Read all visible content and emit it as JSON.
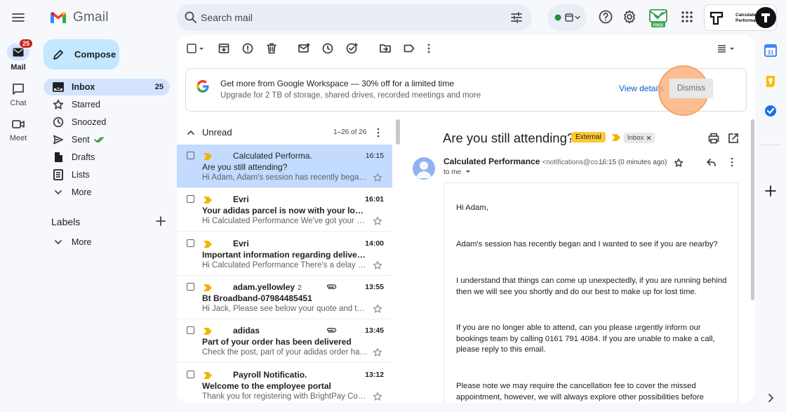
{
  "header": {
    "app_name": "Gmail",
    "search_placeholder": "Search mail",
    "account_label": "Calculated Performance"
  },
  "rail": {
    "mail_label": "Mail",
    "mail_badge": "25",
    "chat_label": "Chat",
    "meet_label": "Meet"
  },
  "nav": {
    "compose_label": "Compose",
    "items": [
      {
        "label": "Inbox",
        "count": "25"
      },
      {
        "label": "Starred"
      },
      {
        "label": "Snoozed"
      },
      {
        "label": "Sent"
      },
      {
        "label": "Drafts"
      },
      {
        "label": "Lists"
      },
      {
        "label": "More"
      }
    ],
    "labels_title": "Labels",
    "labels_more": "More"
  },
  "banner": {
    "title": "Get more from Google Workspace — 30% off for a limited time",
    "subtitle": "Upgrade for 2 TB of storage, shared drives, recorded meetings and more",
    "view_details": "View details",
    "dismiss": "Dismiss"
  },
  "list": {
    "section": "Unread",
    "range": "1–26 of 26",
    "messages": [
      {
        "sender": "Calculated Performa.",
        "count": "",
        "time": "16:15",
        "subject": "Are you still attending?",
        "snippet": "Hi Adam, Adam's session has recently began and I wanted to see if you are nearby?",
        "selected": true,
        "attachment": false
      },
      {
        "sender": "Evri",
        "count": "",
        "time": "16:01",
        "subject": "Your adidas parcel is now with your local Evri courier",
        "snippet": "Hi Calculated Performance We've got your adidas parcel",
        "selected": false,
        "attachment": false
      },
      {
        "sender": "Evri",
        "count": "",
        "time": "14:00",
        "subject": "Important information regarding delivery of your parcel",
        "snippet": "Hi Calculated Performance There's a delay with your parcel",
        "selected": false,
        "attachment": false
      },
      {
        "sender": "adam.yellowley",
        "count": "2",
        "time": "13:55",
        "subject": "Bt Broadband-07984485451",
        "snippet": "Hi Jack, Please see below your quote and the details",
        "selected": false,
        "attachment": true
      },
      {
        "sender": "adidas",
        "count": "",
        "time": "13:45",
        "subject": "Part of your order has been delivered",
        "snippet": "Check the post, part of your adidas order has arrived",
        "selected": false,
        "attachment": true
      },
      {
        "sender": "Payroll Notificatio.",
        "count": "",
        "time": "13:12",
        "subject": "Welcome to the employee portal",
        "snippet": "Thank you for registering with BrightPay Connect",
        "selected": false,
        "attachment": false
      }
    ]
  },
  "reader": {
    "subject": "Are you still attending?",
    "tag_external": "External",
    "tag_inbox": "Inbox",
    "from_name": "Calculated Performance",
    "from_addr": "<notifications@co...",
    "time": "16:15 (0 minutes ago)",
    "to": "to me",
    "body": [
      "Hi Adam,",
      "Adam's session has recently began and I wanted to see if you are nearby?",
      "I understand that things can come up unexpectedly, if you are running behind then we will see you shortly and do our best to make up for lost time.",
      "If you are no longer able to attend, can you please urgently inform our bookings team by calling 0161 791 4084. If you are unable to make a call, please reply to this email.",
      "Please note we may require the cancellation fee to cover the missed appointment, however, we will always explore other possibilities before"
    ]
  },
  "ext_badge": "FREE",
  "colors": {
    "accent": "#0b57d0",
    "compose_bg": "#c2e7ff",
    "selected_row": "#c2dbff",
    "external_tag": "#fcc934",
    "badge_red": "#c5221f"
  }
}
